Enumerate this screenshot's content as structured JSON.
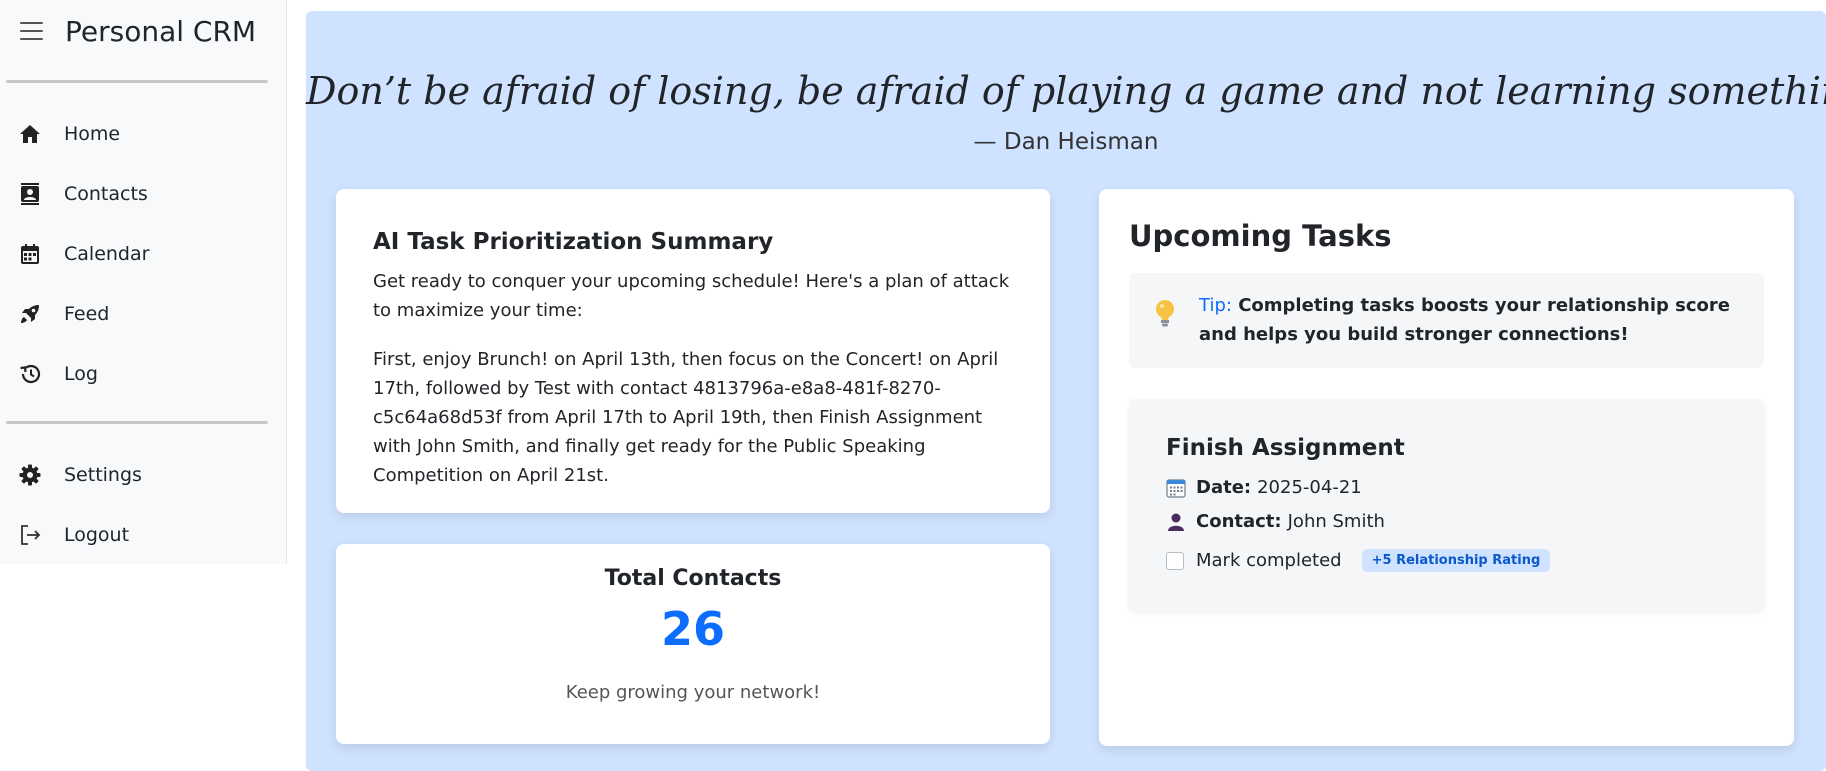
{
  "sidebar": {
    "app_title": "Personal CRM",
    "nav_items": [
      {
        "label": "Home",
        "icon": "home-icon"
      },
      {
        "label": "Contacts",
        "icon": "contacts-icon"
      },
      {
        "label": "Calendar",
        "icon": "calendar-icon"
      },
      {
        "label": "Feed",
        "icon": "rocket-icon"
      },
      {
        "label": "Log",
        "icon": "history-icon"
      }
    ],
    "footer_items": [
      {
        "label": "Settings",
        "icon": "gear-icon"
      },
      {
        "label": "Logout",
        "icon": "logout-icon"
      }
    ]
  },
  "quote": {
    "text": "Don’t be afraid of losing, be afraid of playing a game and not learning something.",
    "author": "— Dan Heisman"
  },
  "ai_summary": {
    "title": "AI Task Prioritization Summary",
    "intro": "Get ready to conquer your upcoming schedule! Here's a plan of attack to maximize your time:",
    "plan": "First, enjoy Brunch! on April 13th, then focus on the Concert! on April 17th, followed by Test with contact 4813796a-e8a8-481f-8270-c5c64a68d53f from April 17th to April 19th, then Finish Assignment with John Smith, and finally get ready for the Public Speaking Competition on April 21st."
  },
  "contacts": {
    "title": "Total Contacts",
    "count": "26",
    "subtitle": "Keep growing your network!"
  },
  "tasks": {
    "title": "Upcoming Tasks",
    "tip_label": "Tip:",
    "tip_text": "Completing tasks boosts your relationship score and helps you build stronger connections!",
    "items": [
      {
        "title": "Finish Assignment",
        "date_label": "Date:",
        "date": "2025-04-21",
        "contact_label": "Contact:",
        "contact": "John Smith",
        "complete_label": "Mark completed",
        "badge": "+5 Relationship Rating"
      }
    ]
  },
  "colors": {
    "accent": "#0d6efd",
    "main_bg": "#cfe2ff",
    "sidebar_bg": "#f8f9fa"
  }
}
